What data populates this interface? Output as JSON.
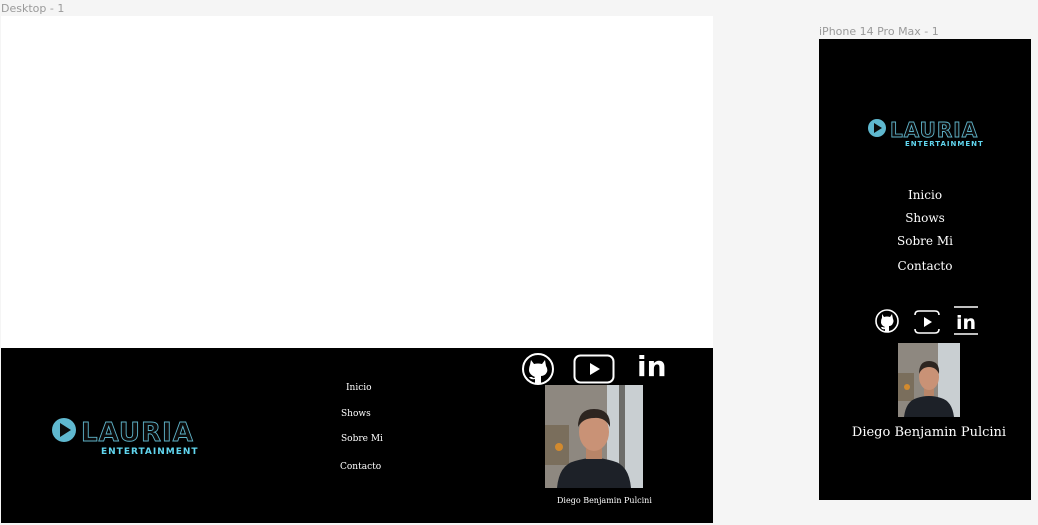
{
  "canvas": {
    "desktop_label": "Desktop - 1",
    "iphone_label": "iPhone 14 Pro Max - 1"
  },
  "brand": {
    "logo_main": "LAURIA",
    "logo_sub": "ENTERTAINMENT"
  },
  "nav": {
    "items": [
      {
        "label": "Inicio"
      },
      {
        "label": "Shows"
      },
      {
        "label": "Sobre Mi"
      },
      {
        "label": "Contacto"
      }
    ]
  },
  "social": {
    "icons": [
      "github-icon",
      "youtube-icon",
      "linkedin-icon"
    ],
    "linkedin_text": "in"
  },
  "profile": {
    "name": "Diego Benjamin Pulcini"
  },
  "colors": {
    "footer_bg": "#000000",
    "accent": "#61d6ef",
    "text": "#ffffff"
  }
}
